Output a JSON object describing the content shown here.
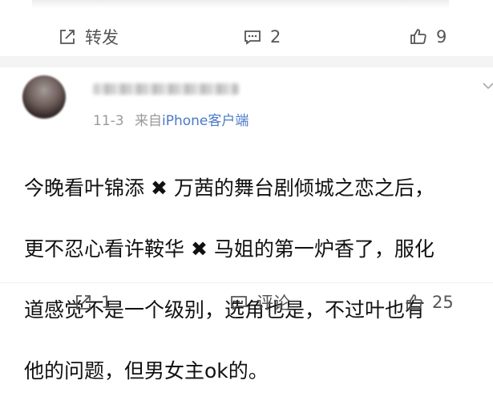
{
  "top_actions": {
    "repost_label": "转发",
    "comment_count": "2",
    "like_count": "9"
  },
  "comment": {
    "date": "11-3",
    "source_prefix": "来自",
    "source_name": "iPhone客户端",
    "lines": [
      "今晚看叶锦添 ✖ 万茜的舞台剧倾城之恋之后，",
      "更不忍心看许鞍华 ✖ 马姐的第一炉香了，服化",
      "道感觉不是一个级别，选角也是，不过叶也有",
      "他的问题，但男女主ok的。"
    ]
  },
  "bottom_actions": {
    "repost_count": "1",
    "comment_label": "评论",
    "like_count": "25"
  },
  "colors": {
    "link": "#4a79c8",
    "meta": "#9a9a9a",
    "separator": "#f4f4f4"
  },
  "icons": [
    "share-icon",
    "comment-icon",
    "like-icon",
    "chevron-down-icon"
  ]
}
